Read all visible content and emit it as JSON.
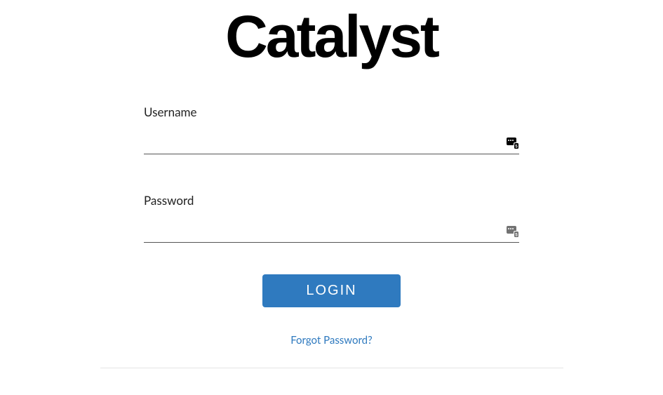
{
  "logo": {
    "text": "Catalyst"
  },
  "form": {
    "username_label": "Username",
    "username_value": "",
    "password_label": "Password",
    "password_value": "",
    "login_button": "LOGIN",
    "forgot_link": "Forgot Password?"
  },
  "colors": {
    "accent": "#2f7abf",
    "text": "#222222"
  }
}
